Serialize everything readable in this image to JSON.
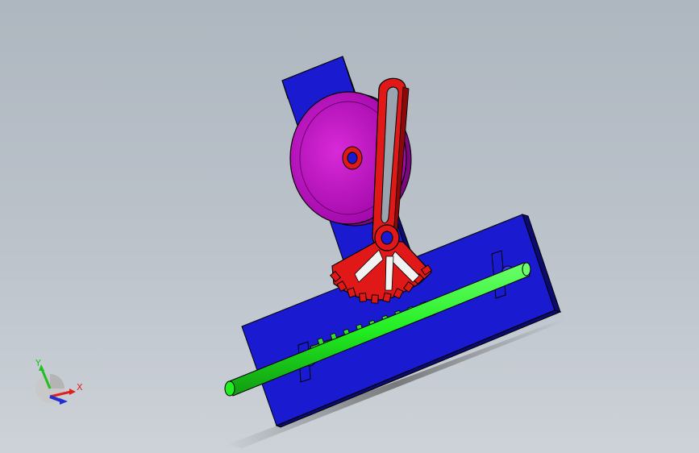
{
  "viewport": {
    "background_top": "#aeb6bf",
    "background_bottom": "#cdd2d8"
  },
  "triad": {
    "x_label": "X",
    "y_label": "Y",
    "x_color": "#e02020",
    "y_color": "#20c020",
    "z_color": "#2030d0"
  },
  "model": {
    "parts": [
      "base-plate",
      "upright-plate",
      "crank-disk",
      "slotted-lever",
      "sector-gear",
      "rack",
      "rack-shaft",
      "shaft-supports"
    ],
    "colors": {
      "base_plate": "#1a1ad0",
      "crank_disk": "#cc10cc",
      "lever": "#e01818",
      "shaft": "#22ee22",
      "rack": "#33dd33"
    }
  }
}
